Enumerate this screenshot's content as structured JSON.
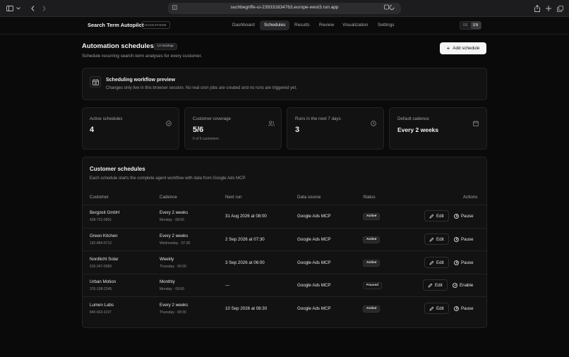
{
  "browser": {
    "url": "suchbegriffe-ui-239331834763.europe-west3.run.app"
  },
  "app": {
    "brand": "Search Term Autopilot",
    "brand_tag": "HACKATHON",
    "nav": [
      "Dashboard",
      "Schedules",
      "Results",
      "Review",
      "Visualization",
      "Settings"
    ],
    "active_nav": "Schedules",
    "lang": [
      "DE",
      "EN"
    ],
    "active_lang": "EN"
  },
  "header": {
    "title": "Automation schedules",
    "tag": "UI mockup",
    "subtitle": "Schedule recurring search-term analyses for every customer.",
    "add_button": "Add schedule"
  },
  "preview": {
    "title": "Scheduling workflow preview",
    "text": "Changes only live in this browser session. No real cron jobs are created and no runs are triggered yet."
  },
  "stats": [
    {
      "label": "Active schedules",
      "value": "4",
      "sub": "",
      "icon": "check-circle-icon"
    },
    {
      "label": "Customer coverage",
      "value": "5/6",
      "sub": "5 of 6 customers",
      "icon": "users-icon"
    },
    {
      "label": "Runs in the next 7 days",
      "value": "3",
      "sub": "",
      "icon": "clock-icon"
    },
    {
      "label": "Default cadence",
      "value": "Every 2 weeks",
      "sub": "",
      "icon": "calendar-icon"
    }
  ],
  "schedules": {
    "title": "Customer schedules",
    "subtitle": "Each schedule starts the complete agent workflow with data from Google Ads MCP.",
    "columns": [
      "Customer",
      "Cadence",
      "Next run",
      "Data source",
      "Status",
      "Actions"
    ],
    "rows": [
      {
        "customer": "Bergzeit GmbH",
        "id": "428-731-9901",
        "cadence": "Every 2 weeks",
        "cadence_detail": "Monday · 08:00",
        "next_run": "31 Aug 2026 at 08:00",
        "source": "Google Ads MCP",
        "status": "Active",
        "edit": "Edit",
        "action": "Pause"
      },
      {
        "customer": "Green Kitchen",
        "id": "192-884-5712",
        "cadence": "Every 2 weeks",
        "cadence_detail": "Wednesday · 07:30",
        "next_run": "2 Sep 2026 at 07:30",
        "source": "Google Ads MCP",
        "status": "Active",
        "edit": "Edit",
        "action": "Pause"
      },
      {
        "customer": "Nordlicht Solar",
        "id": "915-247-6083",
        "cadence": "Weekly",
        "cadence_detail": "Thursday · 06:00",
        "next_run": "3 Sep 2026 at 06:00",
        "source": "Google Ads MCP",
        "status": "Active",
        "edit": "Edit",
        "action": "Pause"
      },
      {
        "customer": "Urban Motion",
        "id": "376-108-2245",
        "cadence": "Monthly",
        "cadence_detail": "Monday · 09:00",
        "next_run": "—",
        "source": "Google Ads MCP",
        "status": "Paused",
        "edit": "Edit",
        "action": "Enable"
      },
      {
        "customer": "Lumen Labs",
        "id": "840-663-1197",
        "cadence": "Every 2 weeks",
        "cadence_detail": "Thursday · 08:30",
        "next_run": "10 Sep 2026 at 08:30",
        "source": "Google Ads MCP",
        "status": "Active",
        "edit": "Edit",
        "action": "Pause"
      }
    ]
  }
}
